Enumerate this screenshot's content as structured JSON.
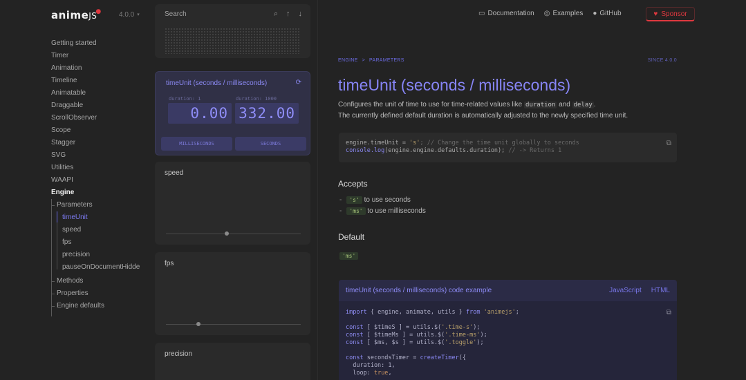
{
  "brand": {
    "logo": "anime",
    "logo_suffix": "JS",
    "version": "4.0.0"
  },
  "sidebar": {
    "items": [
      "Getting started",
      "Timer",
      "Animation",
      "Timeline",
      "Animatable",
      "Draggable",
      "ScrollObserver",
      "Scope",
      "Stagger",
      "SVG",
      "Utilities",
      "WAAPI"
    ],
    "active_section": "Engine",
    "sub": {
      "parameters": "Parameters",
      "methods": "Methods",
      "properties": "Properties",
      "engine_defaults": "Engine defaults"
    },
    "params": [
      "timeUnit",
      "speed",
      "fps",
      "precision",
      "pauseOnDocumentHidde"
    ]
  },
  "demo": {
    "search_placeholder": "Search",
    "timeunit": {
      "title": "timeUnit (seconds / milliseconds)",
      "left_label": "duration: 1",
      "left_value": "0.00",
      "right_label": "duration: 1000",
      "right_value": "332.00",
      "btn_ms": "MILLISECONDS",
      "btn_s": "SECONDS"
    },
    "speed_label": "speed",
    "speed_level": 0.45,
    "fps_label": "fps",
    "fps_level": 0.24,
    "precision_label": "precision"
  },
  "header": {
    "documentation": "Documentation",
    "examples": "Examples",
    "github": "GitHub",
    "sponsor": "Sponsor"
  },
  "content": {
    "crumb1": "ENGINE",
    "crumb_sep": ">",
    "crumb2": "PARAMETERS",
    "since": "SINCE 4.0.0",
    "title": "timeUnit (seconds / milliseconds)",
    "desc1_a": "Configures the unit of time to use for time-related values like ",
    "desc1_code1": "duration",
    "desc1_b": " and ",
    "desc1_code2": "delay",
    "desc1_c": ".",
    "desc2": "The currently defined default duration is automatically adjusted to the newly specified time unit.",
    "code1_line1_a": "engine.timeUnit = ",
    "code1_line1_str": "'s'",
    "code1_line1_cm": "; // Change the time unit globally to seconds",
    "code1_line2_fn": "console.log",
    "code1_line2_b": "(engine.engine.defaults.duration); ",
    "code1_line2_cm": "// -> Returns 1",
    "accepts_heading": "Accepts",
    "accept1_val": "'s'",
    "accept1_text": " to use seconds",
    "accept2_val": "'ms'",
    "accept2_text": " to use milliseconds",
    "default_heading": "Default",
    "default_val": "'ms'",
    "example_title": "timeUnit (seconds / milliseconds) code example",
    "tab_js": "JavaScript",
    "tab_html": "HTML"
  }
}
